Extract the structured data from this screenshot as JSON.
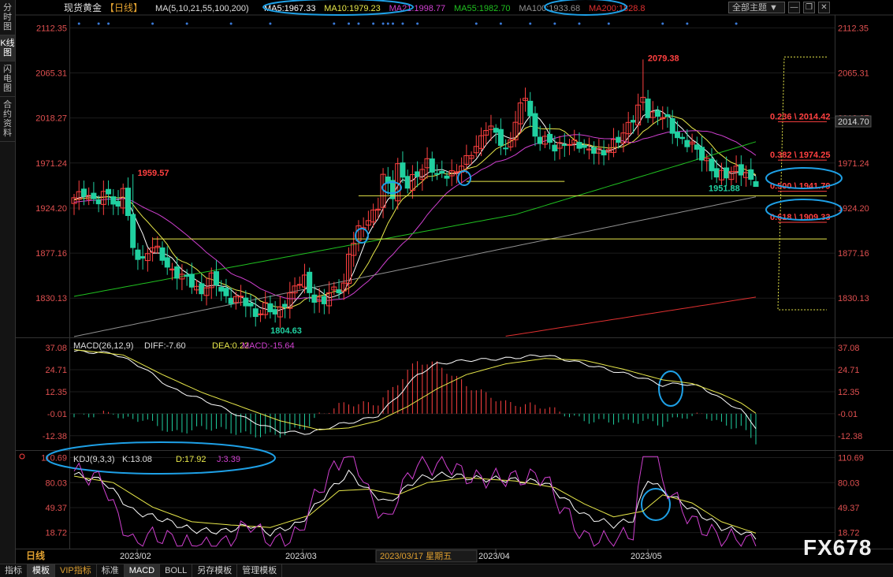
{
  "window": {
    "title": "现货黄金",
    "period": "【日线】",
    "watermark": "FX678",
    "period_label": "日线"
  },
  "theme_select": {
    "label": "全部主题"
  },
  "toolbar_icons": [
    "minus-icon",
    "restore-icon",
    "close-icon"
  ],
  "left_tabs": [
    {
      "label": "分时图",
      "active": false
    },
    {
      "label": "K线图",
      "active": true
    },
    {
      "label": "闪电图",
      "active": false
    },
    {
      "label": "合约资料",
      "active": false
    }
  ],
  "bottom_tabs": [
    {
      "label": "指标",
      "active": false
    },
    {
      "label": "模板",
      "active": true
    },
    {
      "label": "VIP指标",
      "active": false,
      "vip": true
    },
    {
      "label": "标准",
      "active": false
    },
    {
      "label": "MACD",
      "active": true
    },
    {
      "label": "BOLL",
      "active": false
    },
    {
      "label": "另存模板",
      "active": false
    },
    {
      "label": "管理模板",
      "active": false
    }
  ],
  "chart_data": [
    {
      "type": "candlestick",
      "legend_prefix": "MA(5,10,21,55,100,200)",
      "series": [
        {
          "name": "MA5",
          "label": "MA5:1967.33",
          "color": "#ffffff"
        },
        {
          "name": "MA10",
          "label": "MA10:1979.23",
          "color": "#e8e84a"
        },
        {
          "name": "MA21",
          "label": "MA21:1998.77",
          "color": "#d040d0"
        },
        {
          "name": "MA55",
          "label": "MA55:1982.70",
          "color": "#20c020"
        },
        {
          "name": "MA100",
          "label": "MA100:1933.68",
          "color": "#909090"
        },
        {
          "name": "MA200",
          "label": "MA200:1828.8",
          "color": "#e03030"
        }
      ],
      "ylim": [
        1790,
        2125
      ],
      "y_ticks": [
        "2112.35",
        "2065.31",
        "2018.27",
        "1971.24",
        "1924.20",
        "1877.16",
        "1830.13"
      ],
      "x_ticks": [
        "2023/02",
        "2023/03",
        "2023/04",
        "2023/05"
      ],
      "cursor_date": "2023/03/17 星期五",
      "current_price": "2014.70",
      "annotations": {
        "high": "2079.38",
        "feb_high": "1959.57",
        "low": "1804.63",
        "last_low": "1951.88"
      },
      "fib_levels": [
        {
          "label": "0.236 \\ 2014.42",
          "value": 2014.42
        },
        {
          "label": "0.382 \\ 1974.25",
          "value": 1974.25
        },
        {
          "label": "0.500 \\ 1941.79",
          "value": 1941.79
        },
        {
          "label": "0.618 \\ 1909.33",
          "value": 1909.33
        }
      ],
      "horizontal_lines": [
        1937.0,
        1892.0
      ]
    },
    {
      "type": "macd",
      "legend": {
        "title": "MACD(26,12,9)",
        "diff": "DIFF:-7.60",
        "dea": "DEA:0.22",
        "macd": "MACD:-15.64"
      },
      "ylim": [
        -20,
        42
      ],
      "y_ticks": [
        "37.08",
        "24.71",
        "12.35",
        "-0.01",
        "-12.38"
      ]
    },
    {
      "type": "kdj",
      "legend": {
        "title": "KDJ(9,3,3)",
        "k": "K:13.08",
        "d": "D:17.92",
        "j": "J:3.39"
      },
      "ylim": [
        0,
        118
      ],
      "y_ticks": [
        "110.69",
        "80.03",
        "49.37",
        "18.72"
      ]
    }
  ]
}
